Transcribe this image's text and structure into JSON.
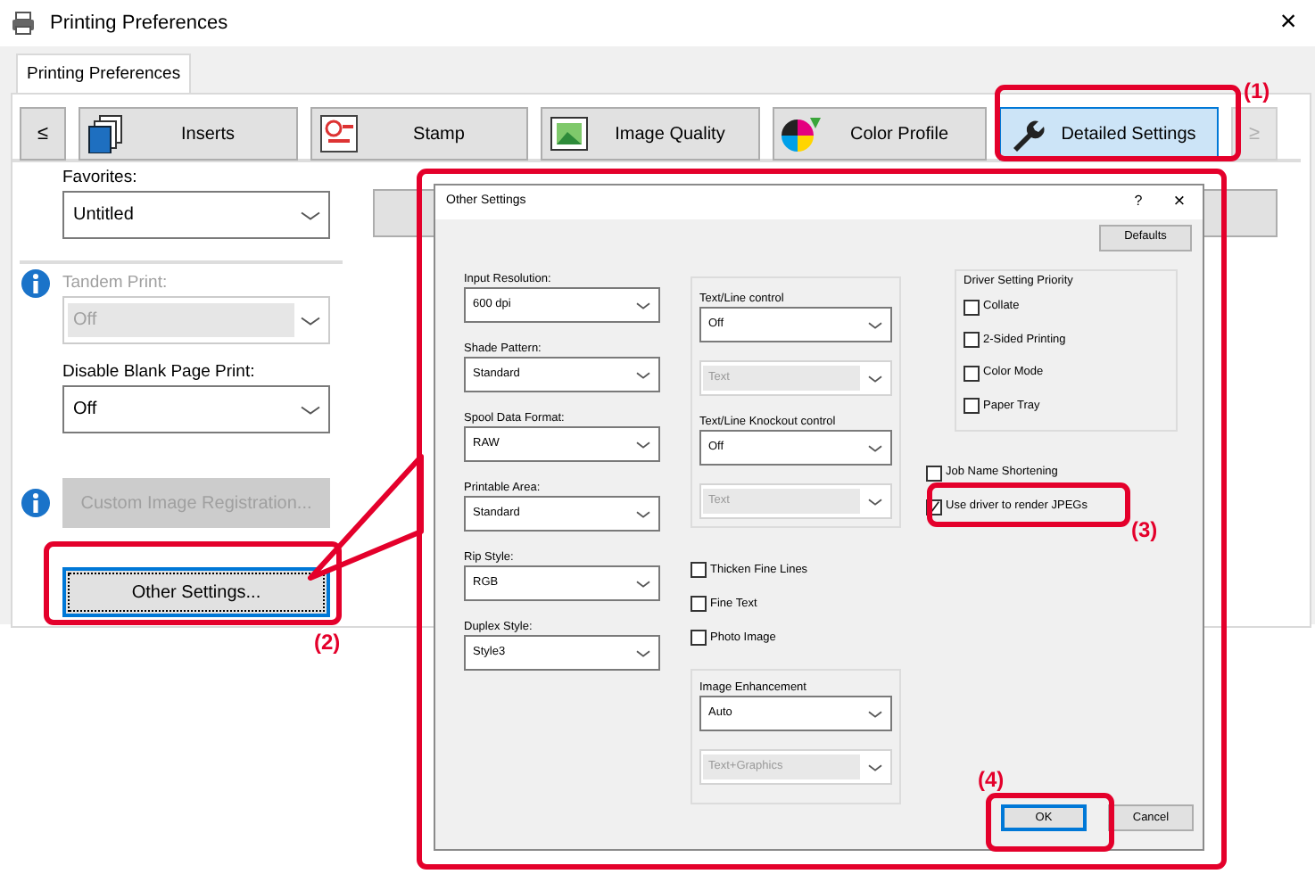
{
  "window": {
    "title": "Printing Preferences",
    "close": "×"
  },
  "tabs": [
    {
      "label": "Printing Preferences",
      "selected": true
    }
  ],
  "toolbar": {
    "prev": "≤",
    "next": "≥",
    "next_disabled": true,
    "items": [
      {
        "label": "Inserts",
        "kind": "inserts",
        "selected": false
      },
      {
        "label": "Stamp",
        "kind": "stamp",
        "selected": false
      },
      {
        "label": "Image Quality",
        "kind": "image",
        "selected": false
      },
      {
        "label": "Color Profile",
        "kind": "color",
        "selected": false
      },
      {
        "label": "Detailed Settings",
        "kind": "wrench",
        "selected": true
      }
    ]
  },
  "settings": [
    {
      "kind": "select",
      "label": "Favorites:",
      "value": "Untitled",
      "info": false,
      "disabled": false
    },
    {
      "kind": "select",
      "label": "Tandem Print:",
      "value": "Off",
      "info": true,
      "disabled": true
    },
    {
      "kind": "select",
      "label": "Disable Blank Page Print:",
      "value": "Off",
      "info": false,
      "disabled": false
    },
    {
      "kind": "button",
      "label": "Custom Image Registration...",
      "info": true,
      "disabled": true
    },
    {
      "kind": "button",
      "label": "Other Settings...",
      "info": false,
      "disabled": false
    }
  ],
  "dialog": {
    "title": "Other Settings",
    "help": "?",
    "close": "×",
    "defaults_button": "Defaults",
    "fields": [
      {
        "label": "Input Resolution:",
        "value": "600 dpi"
      },
      {
        "label": "Shade Pattern:",
        "value": "Standard"
      },
      {
        "label": "Spool Data Format:",
        "value": "RAW"
      },
      {
        "label": "Printable Area:",
        "value": "Standard"
      },
      {
        "label": "Rip Style:",
        "value": "RGB"
      },
      {
        "label": "Duplex Style:",
        "value": "Style3"
      }
    ],
    "controls": [
      {
        "label": "Text/Line control",
        "value": "Off",
        "sub_value": "Text",
        "sub_disabled": true
      },
      {
        "label": "Text/Line Knockout control",
        "value": "Off",
        "sub_value": "Text",
        "sub_disabled": true
      }
    ],
    "checkboxes": [
      {
        "label": "Thicken Fine Lines",
        "checked": false
      },
      {
        "label": "Fine Text",
        "checked": false
      },
      {
        "label": "Photo Image",
        "checked": false
      }
    ],
    "image_enhancement": {
      "label": "Image Enhancement",
      "value": "Auto",
      "sub_value": "Text+Graphics",
      "sub_disabled": true
    },
    "priority": {
      "title": "Driver Setting Priority",
      "items": [
        {
          "label": "Collate",
          "checked": false
        },
        {
          "label": "2-Sided Printing",
          "checked": false
        },
        {
          "label": "Color Mode",
          "checked": false
        },
        {
          "label": "Paper Tray",
          "checked": false
        }
      ]
    },
    "options": [
      {
        "label": "Job Name Shortening",
        "checked": false
      },
      {
        "label": "Use driver to render JPEGs",
        "checked": true
      }
    ],
    "buttons": [
      {
        "label": "OK",
        "default": true
      },
      {
        "label": "Cancel",
        "default": false
      }
    ]
  },
  "callouts": [
    {
      "label": "(1)"
    },
    {
      "label": "(2)"
    },
    {
      "label": "(3)"
    },
    {
      "label": "(4)"
    }
  ]
}
